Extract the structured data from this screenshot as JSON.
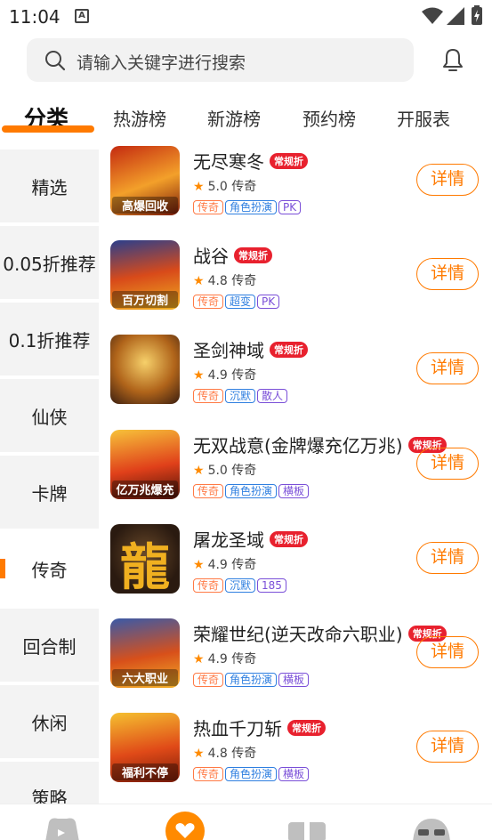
{
  "status": {
    "time": "11:04",
    "a_icon": "A"
  },
  "search": {
    "placeholder": "请输入关键字进行搜索"
  },
  "tabs": [
    {
      "label": "分类"
    },
    {
      "label": "热游榜"
    },
    {
      "label": "新游榜"
    },
    {
      "label": "预约榜"
    },
    {
      "label": "开服表"
    }
  ],
  "sidebar": [
    {
      "label": "精选"
    },
    {
      "label": "0.05折推荐"
    },
    {
      "label": "0.1折推荐"
    },
    {
      "label": "仙侠"
    },
    {
      "label": "卡牌"
    },
    {
      "label": "传奇"
    },
    {
      "label": "回合制"
    },
    {
      "label": "休闲"
    },
    {
      "label": "策略"
    }
  ],
  "games": [
    {
      "name": "无尽寒冬",
      "badge": "常规折",
      "rating": "5.0",
      "genre": "传奇",
      "tags": [
        "传奇",
        "角色扮演",
        "PK"
      ],
      "thumb_caption": "高爆回收",
      "detail": "详情"
    },
    {
      "name": "战谷",
      "badge": "常规折",
      "rating": "4.8",
      "genre": "传奇",
      "tags": [
        "传奇",
        "超变",
        "PK"
      ],
      "thumb_caption": "百万切割",
      "detail": "详情"
    },
    {
      "name": "圣剑神域",
      "badge": "常规折",
      "rating": "4.9",
      "genre": "传奇",
      "tags": [
        "传奇",
        "沉默",
        "散人"
      ],
      "thumb_caption": "",
      "detail": "详情"
    },
    {
      "name": "无双战意(金牌爆充亿万兆)",
      "badge": "常规折",
      "rating": "5.0",
      "genre": "传奇",
      "tags": [
        "传奇",
        "角色扮演",
        "横板"
      ],
      "thumb_caption": "亿万兆爆充",
      "detail": "详情"
    },
    {
      "name": "屠龙圣域",
      "badge": "常规折",
      "rating": "4.9",
      "genre": "传奇",
      "tags": [
        "传奇",
        "沉默",
        "185"
      ],
      "thumb_caption": "",
      "detail": "详情"
    },
    {
      "name": "荣耀世纪(逆天改命六职业)",
      "badge": "常规折",
      "rating": "4.9",
      "genre": "传奇",
      "tags": [
        "传奇",
        "角色扮演",
        "横板"
      ],
      "thumb_caption": "六大职业",
      "detail": "详情"
    },
    {
      "name": "热血千刀斩",
      "badge": "常规折",
      "rating": "4.8",
      "genre": "传奇",
      "tags": [
        "传奇",
        "角色扮演",
        "横板"
      ],
      "thumb_caption": "福利不停",
      "detail": "详情"
    }
  ],
  "colors": {
    "accent": "#ff7a00",
    "badge": "#e8212e",
    "tag_orange": "#ff7a45",
    "tag_blue": "#2f7fe0",
    "tag_purple": "#7a4fd8"
  }
}
